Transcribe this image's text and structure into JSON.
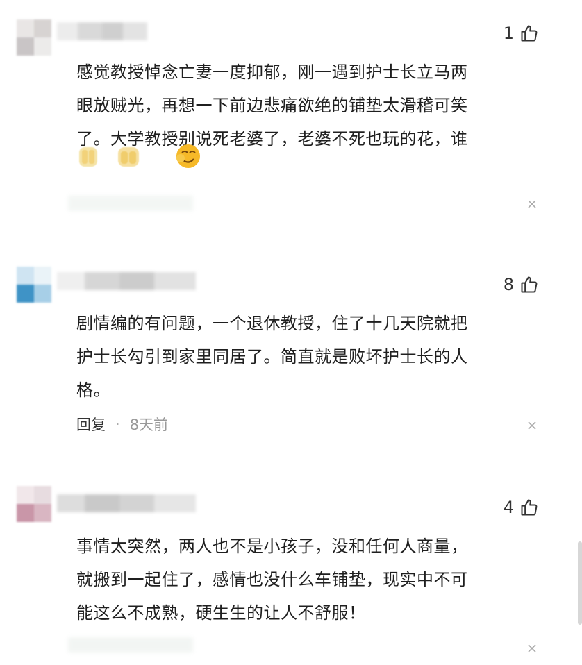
{
  "comments": [
    {
      "likes": "1",
      "text": "感觉教授悼念亡妻一度抑郁，刚一遇到护士长立马两\n眼放贼光，再想一下前边悲痛欲绝的铺垫太滑稽可笑\n了。大学教授别说死老婆了，老婆不死也玩的花，谁",
      "emojis": [
        "pray-emoji",
        "pray-emoji",
        "smirk-emoji"
      ]
    },
    {
      "likes": "8",
      "text": "剧情编的有问题，一个退休教授，住了十几天院就把\n护士长勾引到家里同居了。简直就是败坏护士长的人\n格。",
      "reply_label": "回复",
      "dot": "·",
      "time": "8天前"
    },
    {
      "likes": "4",
      "text": "事情太突然，两人也不是小孩子，没和任何人商量，\n就搬到一起住了，感情也没什么车铺垫，现实中不可\n能这么不成熟，硬生生的让人不舒服！"
    }
  ],
  "colors": {
    "text": "#1f1f1f",
    "muted": "#999999",
    "icon": "#333333"
  }
}
